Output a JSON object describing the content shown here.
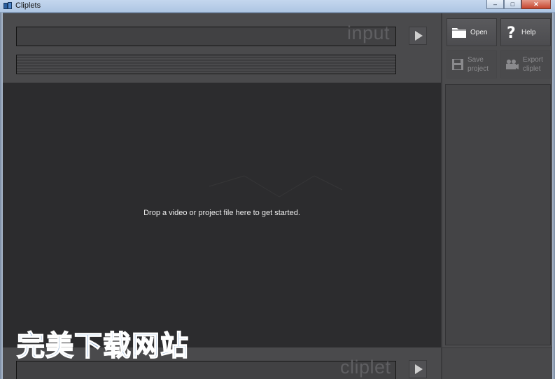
{
  "window": {
    "title": "Cliplets",
    "controls": {
      "minimize": "–",
      "maximize": "□",
      "close": "✕"
    }
  },
  "input_section": {
    "watermark": "input"
  },
  "main": {
    "drop_hint": "Drop a video or project file here to get started."
  },
  "output_section": {
    "watermark": "cliplet"
  },
  "toolbar": {
    "open_label": "Open",
    "help_label": "Help",
    "save_line1": "Save",
    "save_line2": "project",
    "export_line1": "Export",
    "export_line2": "cliplet",
    "icons": {
      "open": "folder-icon",
      "help": "question-mark-icon",
      "save": "floppy-disk-icon",
      "export": "video-camera-icon"
    }
  },
  "overlay": {
    "text": "完美下载网站"
  },
  "colors": {
    "panel": "#4a4a4c",
    "workspace": "#2c2c2e",
    "overlay_text": "#2e6db7"
  }
}
